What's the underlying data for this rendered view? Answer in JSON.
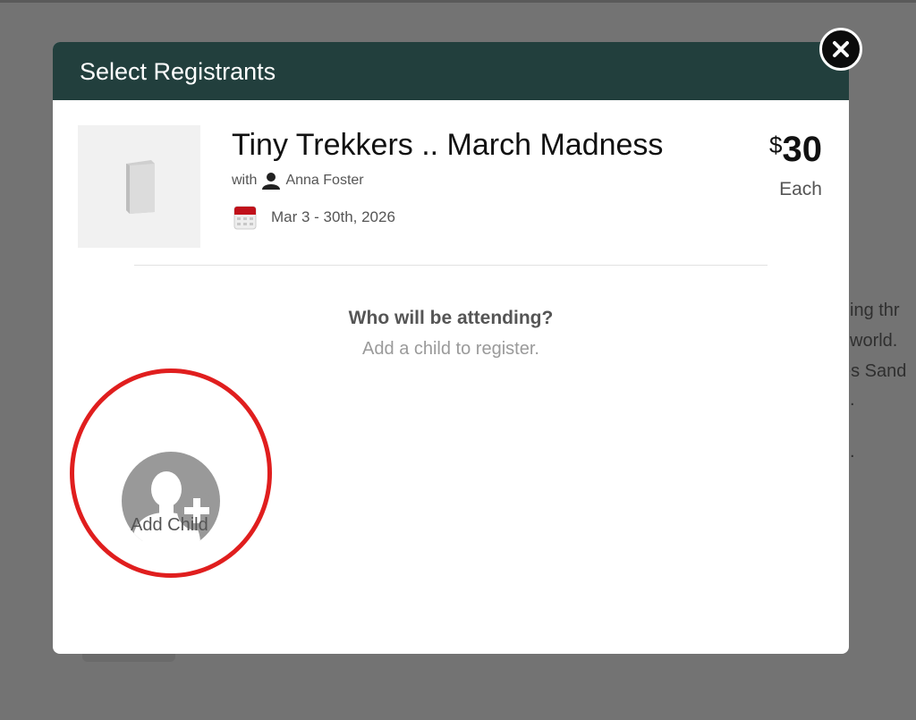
{
  "modal": {
    "title": "Select Registrants",
    "close_icon": "close-icon"
  },
  "event": {
    "thumbnail_icon": "book-icon",
    "title": "Tiny Trekkers .. March Madness",
    "with_label": "with",
    "instructor_icon": "person-icon",
    "instructor": "Anna Foster",
    "calendar_icon": "calendar-icon",
    "dates": "Mar 3 - 30th, 2026",
    "price_currency": "$",
    "price_amount": "30",
    "price_unit": "Each"
  },
  "attendance": {
    "question": "Who will be attending?",
    "hint": "Add a child to register.",
    "add_child_icon": "add-person-icon",
    "add_child_label": "Add Child"
  },
  "background": {
    "lines": [
      "king thr",
      "l world.",
      "es Sand"
    ]
  },
  "colors": {
    "header": "#223f3d",
    "overlay": "#737373",
    "highlight": "#e01e1e",
    "calendar": "#c0101a"
  }
}
